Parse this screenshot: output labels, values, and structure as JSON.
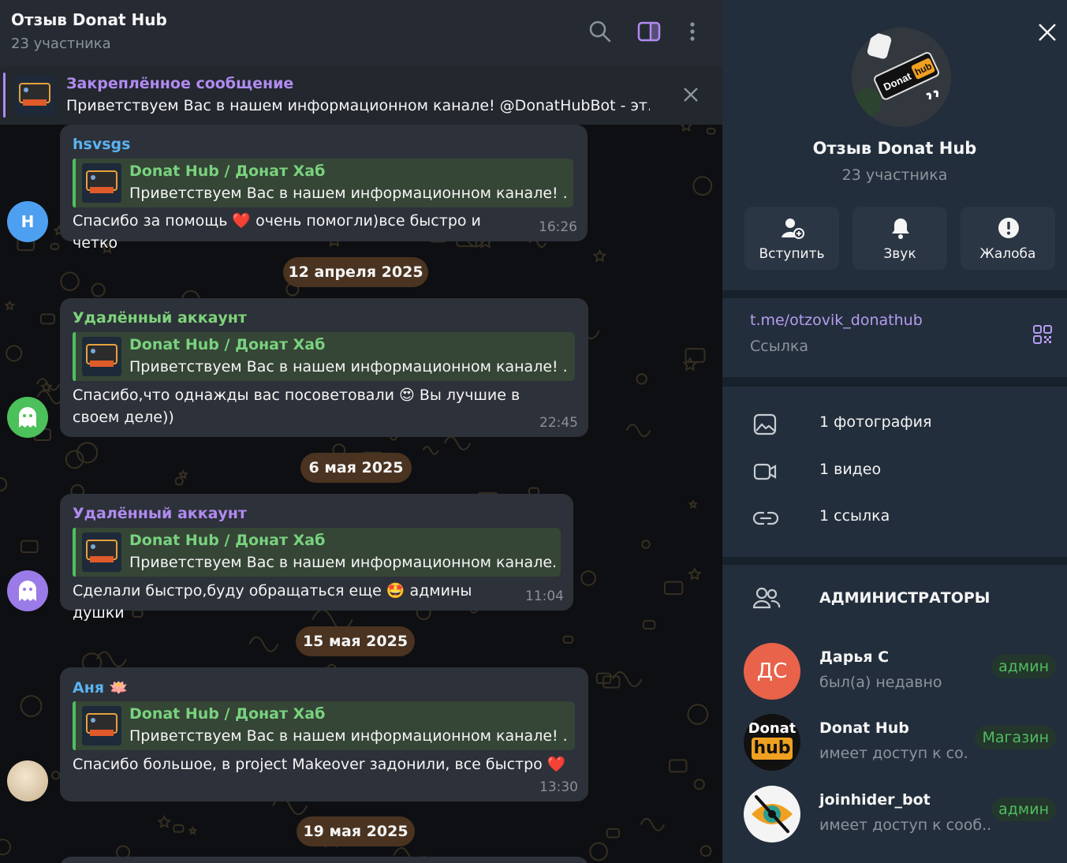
{
  "header": {
    "title": "Отзыв Donat Hub",
    "subtitle": "23 участника"
  },
  "pinned": {
    "title": "Закреплённое сообщение",
    "text": "Приветствуем Вас в нашем информационном канале! @DonatHubBot - эт..."
  },
  "messages": [
    {
      "sender": "hsvsgs",
      "sender_color": "#5ab3f0",
      "reply_title": "Donat Hub / Донат Хаб",
      "reply_text": "Приветствуем Вас в нашем информационном канале! ...",
      "text": "Спасибо за помощь ❤️ очень помогли)все быстро и четко",
      "time": "16:26",
      "avatar_letter": "H",
      "avatar_color": "#4d9ff0"
    },
    {
      "sender": "Удалённый аккаунт",
      "sender_color": "#7ed47a",
      "reply_title": "Donat Hub / Донат Хаб",
      "reply_text": "Приветствуем Вас в нашем информационном канале! ...",
      "text": "Спасибо,что однажды вас посоветовали 😍 Вы лучшие в своем деле))",
      "time": "22:45",
      "avatar_color": "#4cc05a"
    },
    {
      "sender": "Удалённый аккаунт",
      "sender_color": "#b08bf0",
      "reply_title": "Donat Hub / Донат Хаб",
      "reply_text": "Приветствуем Вас в нашем информационном канале...",
      "text": "Сделали быстро,буду обращаться еще 🤩 админы душки",
      "time": "11:04",
      "avatar_color": "#9a7be8"
    },
    {
      "sender": "Аня 🪷",
      "sender_color": "#5ab3f0",
      "reply_title": "Donat Hub / Донат Хаб",
      "reply_text": "Приветствуем Вас в нашем информационном канале! ...",
      "text": "Спасибо большое, в project Makeover задонили, все быстро ❤️",
      "time": "13:30",
      "avatar_color": "#d9c7a8"
    }
  ],
  "dates": [
    "12 апреля 2025",
    "6 мая 2025",
    "15 мая 2025",
    "19 мая 2025"
  ],
  "profile": {
    "name": "Отзыв Donat Hub",
    "members": "23 участника",
    "actions": [
      {
        "label": "Вступить",
        "icon": "add-user-icon"
      },
      {
        "label": "Звук",
        "icon": "bell-icon"
      },
      {
        "label": "Жалоба",
        "icon": "report-icon"
      }
    ],
    "link": "t.me/otzovik_donathub",
    "link_caption": "Ссылка",
    "media": [
      {
        "label": "1 фотография",
        "icon": "photo-icon"
      },
      {
        "label": "1 видео",
        "icon": "video-icon"
      },
      {
        "label": "1 ссылка",
        "icon": "link-icon"
      }
    ],
    "admins_title": "АДМИНИСТРАТОРЫ",
    "admins": [
      {
        "name": "Дарья С",
        "status": "был(а) недавно",
        "role": "админ",
        "initials": "ДС",
        "avatar_color": "#e8634a"
      },
      {
        "name": "Donat Hub",
        "status": "имеет доступ к со...",
        "role": "Магазин",
        "logo_top": "Donat",
        "logo_bottom": "hub"
      },
      {
        "name": "joinhider_bot",
        "status": "имеет доступ к сооб...",
        "role": "админ"
      }
    ]
  },
  "colors": {
    "accent_purple": "#b08bf0",
    "accent_green": "#4fbd5f",
    "link_purple": "#b59cf0",
    "date_pill": "#4a3320"
  }
}
